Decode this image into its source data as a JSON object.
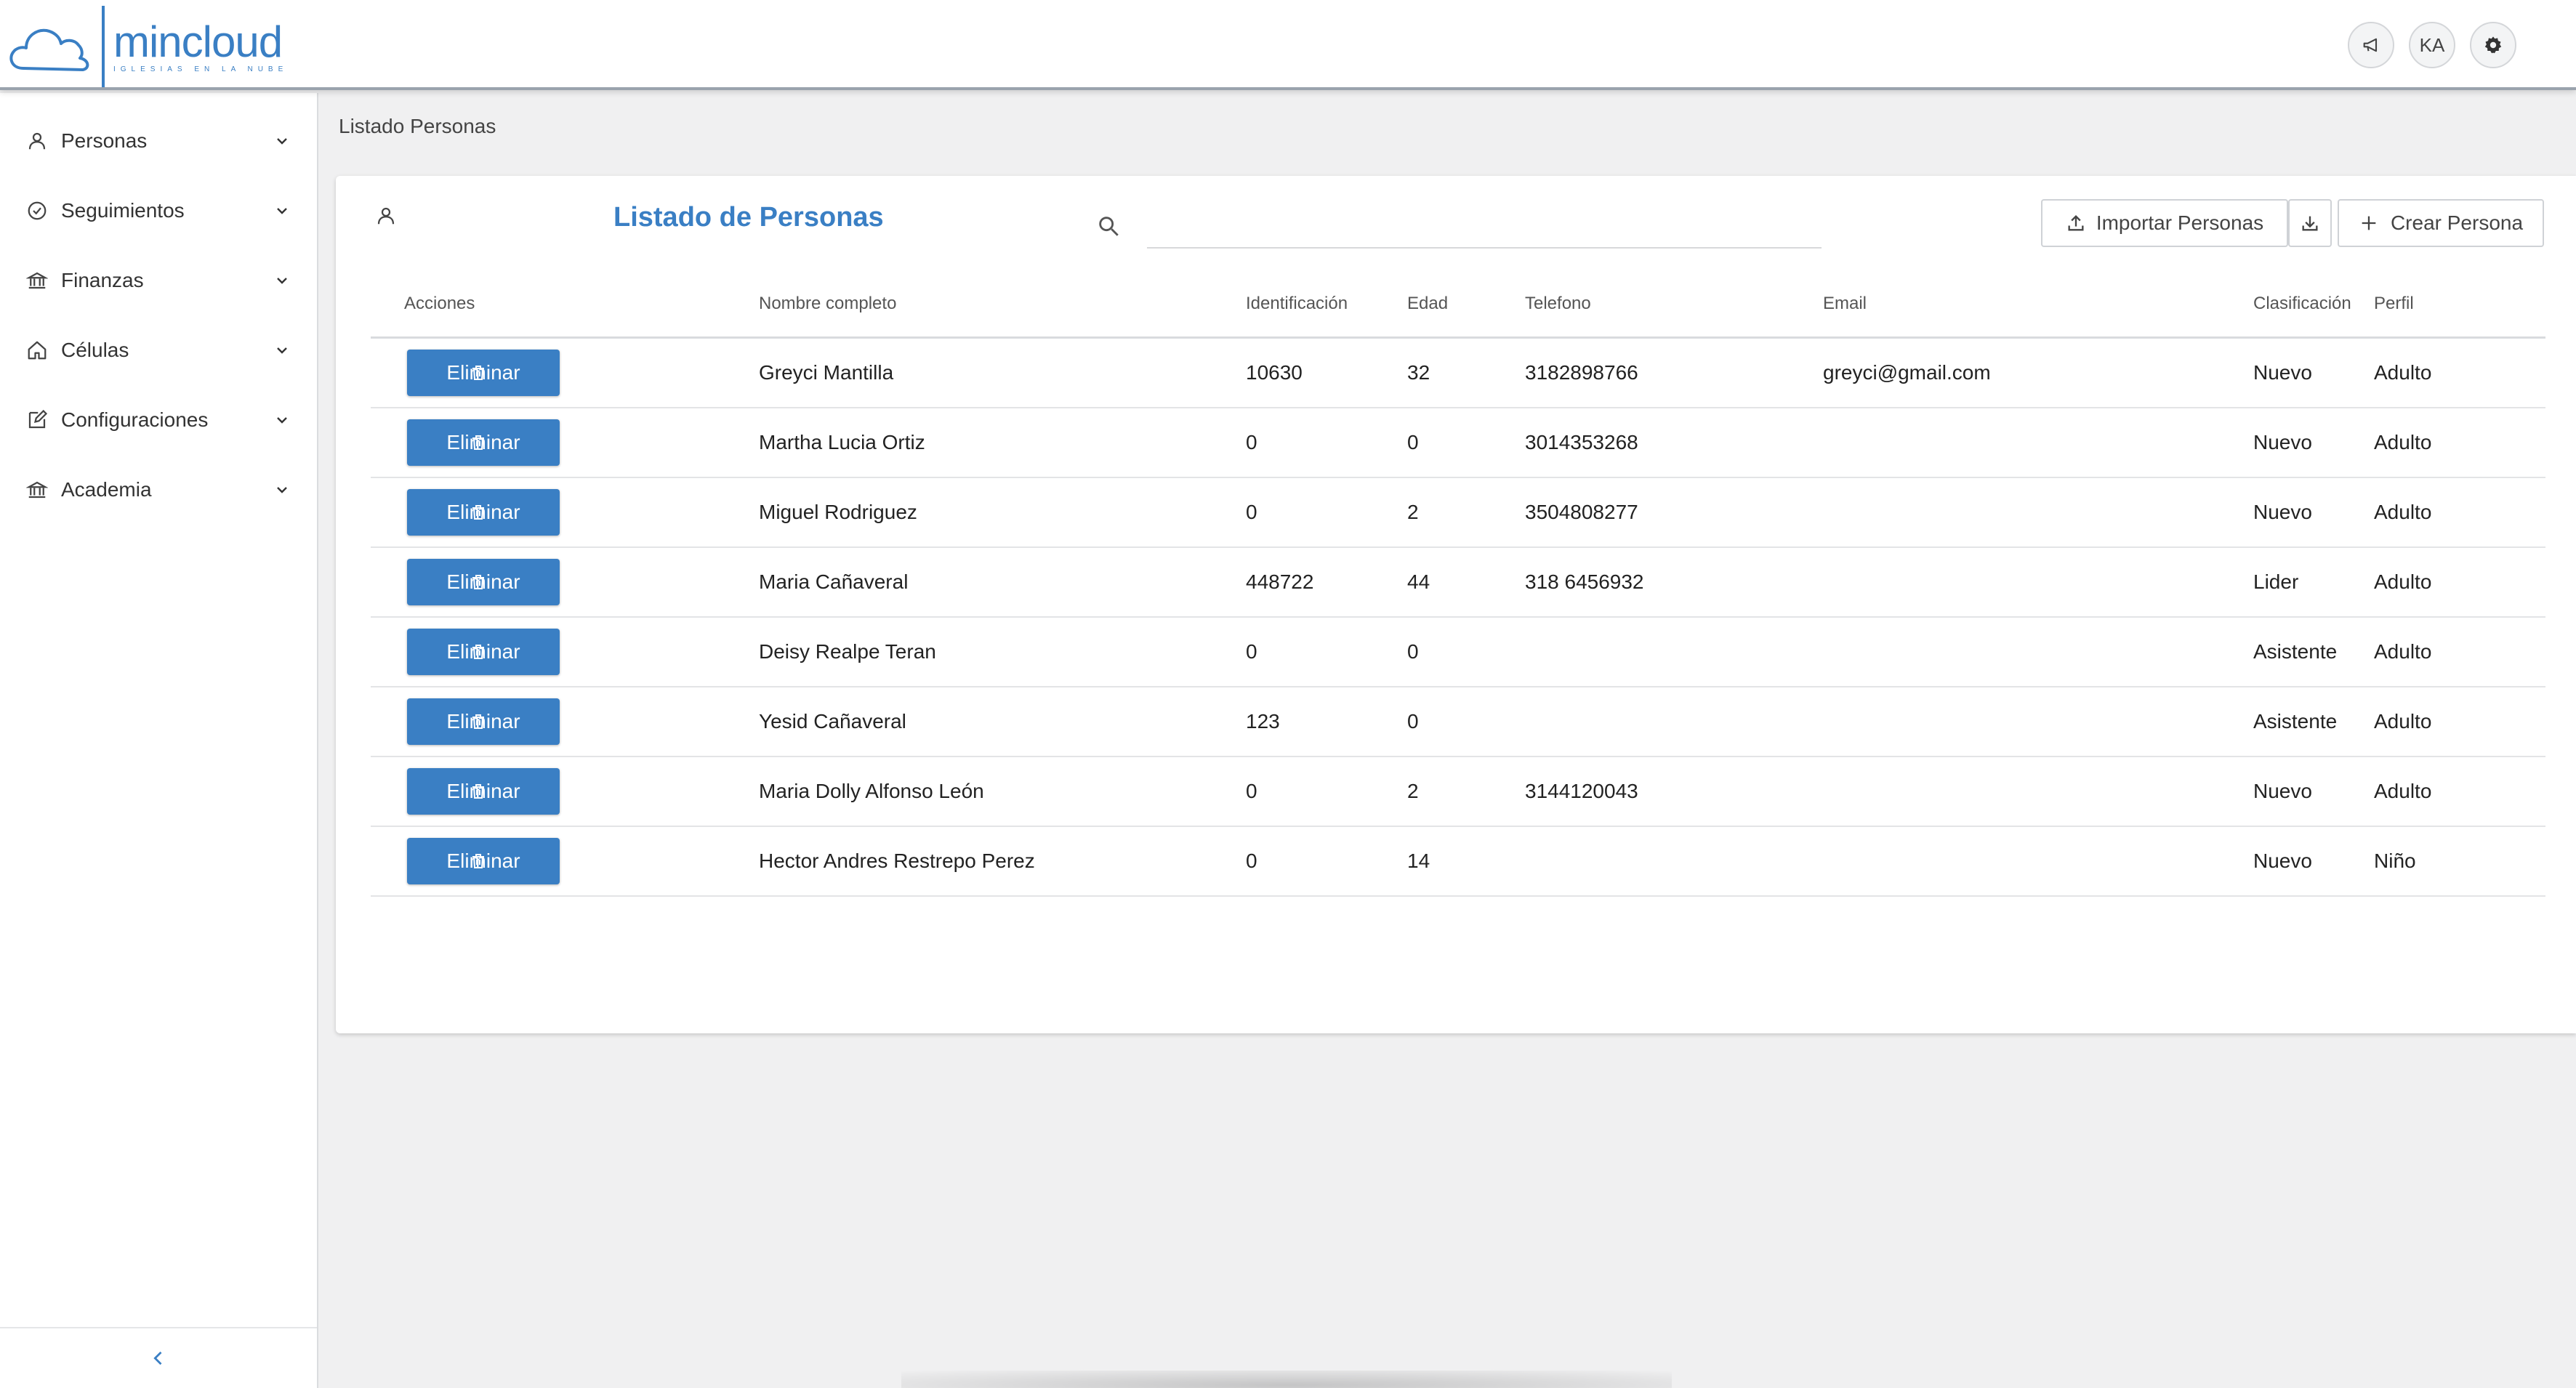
{
  "app": {
    "name": "mincloud",
    "tagline": "IGLESIAS EN LA NUBE",
    "brand_color": "#3a7fc4",
    "header_icons": [
      {
        "name": "megaphone-icon",
        "label": ""
      },
      {
        "name": "user-initials",
        "label": "KA"
      },
      {
        "name": "gear-icon",
        "label": ""
      }
    ]
  },
  "sidebar": {
    "items": [
      {
        "label": "Personas",
        "icon": "person-icon"
      },
      {
        "label": "Seguimientos",
        "icon": "check-circle-icon"
      },
      {
        "label": "Finanzas",
        "icon": "bank-icon"
      },
      {
        "label": "Células",
        "icon": "home-icon"
      },
      {
        "label": "Configuraciones",
        "icon": "edit-icon"
      },
      {
        "label": "Academia",
        "icon": "bank-icon"
      }
    ],
    "collapse_icon": "chevron-left-icon"
  },
  "breadcrumb": "Listado Personas",
  "card": {
    "title": "Listado de Personas",
    "search_placeholder": "",
    "import_label": "Importar Personas",
    "create_label": "Crear Persona"
  },
  "table": {
    "headers": [
      "Acciones",
      "Nombre completo",
      "Identificación",
      "Edad",
      "Telefono",
      "Email",
      "Clasificación",
      "Perfil"
    ],
    "delete_label": "Eliminar",
    "rows": [
      {
        "name": "Greyci Mantilla",
        "id": "10630",
        "age": "32",
        "phone": "3182898766",
        "email": "greyci@gmail.com",
        "class": "Nuevo",
        "profile": "Adulto"
      },
      {
        "name": "Martha Lucia Ortiz",
        "id": "0",
        "age": "0",
        "phone": "3014353268",
        "email": "",
        "class": "Nuevo",
        "profile": "Adulto"
      },
      {
        "name": "Miguel Rodriguez",
        "id": "0",
        "age": "2",
        "phone": "3504808277",
        "email": "",
        "class": "Nuevo",
        "profile": "Adulto"
      },
      {
        "name": "Maria Cañaveral",
        "id": "448722",
        "age": "44",
        "phone": "318 6456932",
        "email": "",
        "class": "Lider",
        "profile": "Adulto"
      },
      {
        "name": "Deisy Realpe Teran",
        "id": "0",
        "age": "0",
        "phone": "",
        "email": "",
        "class": "Asistente",
        "profile": "Adulto"
      },
      {
        "name": "Yesid Cañaveral",
        "id": "123",
        "age": "0",
        "phone": "",
        "email": "",
        "class": "Asistente",
        "profile": "Adulto"
      },
      {
        "name": "Maria Dolly Alfonso León",
        "id": "0",
        "age": "2",
        "phone": "3144120043",
        "email": "",
        "class": "Nuevo",
        "profile": "Adulto"
      },
      {
        "name": "Hector Andres Restrepo Perez",
        "id": "0",
        "age": "14",
        "phone": "",
        "email": "",
        "class": "Nuevo",
        "profile": "Niño"
      }
    ]
  }
}
